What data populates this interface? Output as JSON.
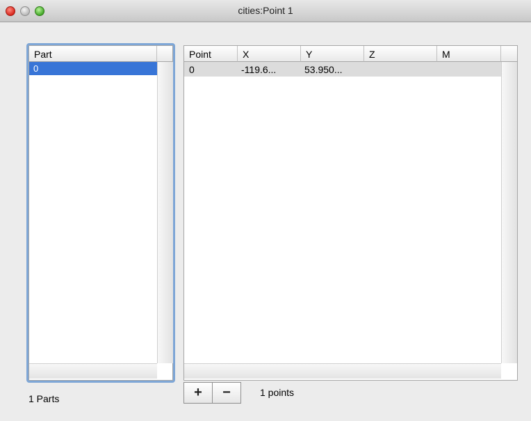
{
  "window": {
    "title": "cities:Point 1"
  },
  "parts_table": {
    "header": "Part",
    "rows": [
      "0"
    ],
    "summary": "1 Parts"
  },
  "points_table": {
    "headers": [
      "Point",
      "X",
      "Y",
      "Z",
      "M"
    ],
    "rows": [
      {
        "point": "0",
        "x": "-119.6...",
        "y": "53.950...",
        "z": "",
        "m": ""
      }
    ],
    "summary": "1 points"
  },
  "buttons": {
    "add": "+",
    "remove": "−"
  },
  "colors": {
    "selection": "#3875d7",
    "focus_ring": "#7ea6d6"
  }
}
